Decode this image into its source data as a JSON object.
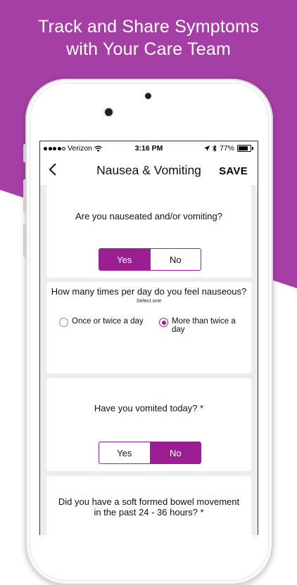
{
  "headline": {
    "line1": "Track and Share Symptoms",
    "line2": "with Your Care Team"
  },
  "status_bar": {
    "carrier": "Verizon",
    "time": "3:16 PM",
    "battery": "77%"
  },
  "nav": {
    "title": "Nausea & Vomiting",
    "save_label": "SAVE"
  },
  "questions": [
    {
      "text": "Are you nauseated and/or vomiting?",
      "options": [
        "Yes",
        "No"
      ],
      "selected": "Yes"
    },
    {
      "text": "How many times per day do you feel nauseous?",
      "hint": "Select one",
      "options": [
        "Once or twice a day",
        "More than twice a day"
      ],
      "selected": "More than twice a day"
    },
    {
      "text": "Have you vomited today? *",
      "options": [
        "Yes",
        "No"
      ],
      "selected": "No"
    },
    {
      "text": "Did you have a soft formed bowel movement in the past 24 - 36 hours? *"
    }
  ],
  "colors": {
    "brand": "#a63fa5",
    "accent": "#9c1e93"
  }
}
